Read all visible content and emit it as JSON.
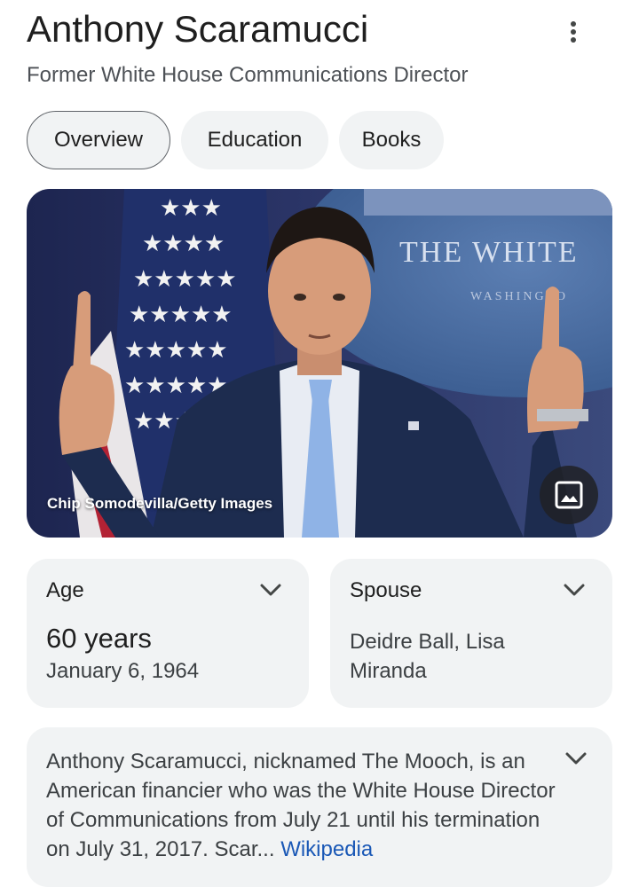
{
  "header": {
    "title": "Anthony Scaramucci",
    "subtitle": "Former White House Communications Director"
  },
  "tabs": [
    {
      "label": "Overview",
      "active": true
    },
    {
      "label": "Education",
      "active": false
    },
    {
      "label": "Books",
      "active": false
    }
  ],
  "photo": {
    "credit": "Chip Somodevilla/Getty Images",
    "background_text_1": "THE WHITE",
    "background_text_2": "WASHINGTO"
  },
  "age_card": {
    "label": "Age",
    "value": "60 years",
    "date": "January 6, 1964"
  },
  "spouse_card": {
    "label": "Spouse",
    "names": [
      "Deidre Ball",
      "Lisa Miranda"
    ],
    "separator": ", "
  },
  "description": {
    "text": "Anthony Scaramucci, nicknamed The Mooch, is an American financier who was the White House Director of Communications from July 21 until his termination on July 31, 2017. Scar",
    "ellipsis": "...",
    "source": "Wikipedia"
  },
  "icons": {
    "more": "more-vert-icon",
    "image": "image-icon",
    "expand": "chevron-down-icon"
  },
  "colors": {
    "link": "#1a58b6",
    "card_bg": "#f1f3f4",
    "text_primary": "#1f1f1f",
    "text_secondary": "#4d5156"
  }
}
